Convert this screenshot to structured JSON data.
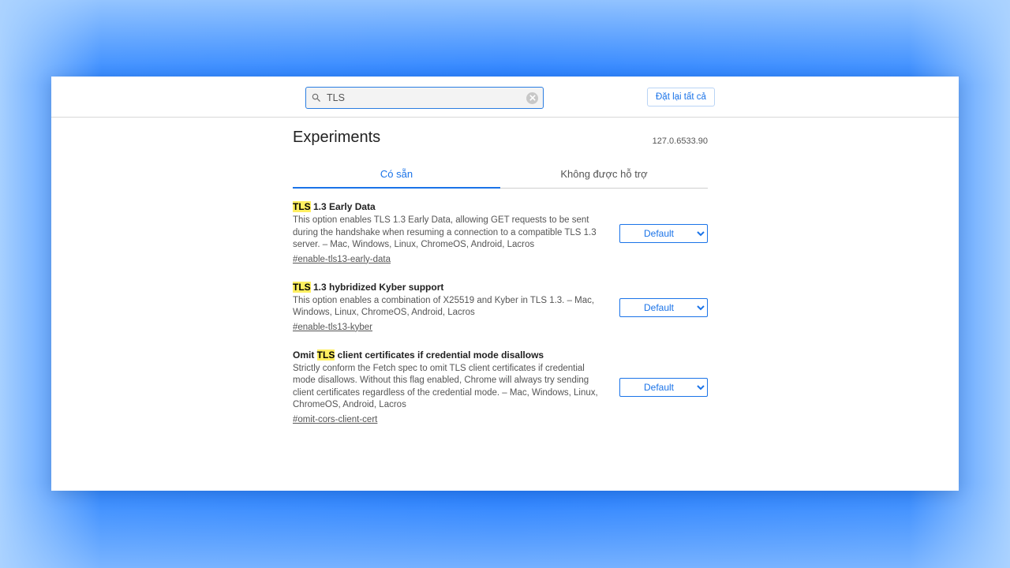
{
  "search": {
    "value": "TLS"
  },
  "reset_label": "Đặt lại tất cả",
  "page_title": "Experiments",
  "version": "127.0.6533.90",
  "tabs": {
    "available": "Có sẵn",
    "unsupported": "Không được hỗ trợ"
  },
  "select": {
    "default_option": "Default"
  },
  "flags": [
    {
      "title_pre": "",
      "title_hl": "TLS",
      "title_post": " 1.3 Early Data",
      "desc": "This option enables TLS 1.3 Early Data, allowing GET requests to be sent during the handshake when resuming a connection to a compatible TLS 1.3 server. – Mac, Windows, Linux, ChromeOS, Android, Lacros",
      "anchor": "#enable-tls13-early-data",
      "value": "Default"
    },
    {
      "title_pre": "",
      "title_hl": "TLS",
      "title_post": " 1.3 hybridized Kyber support",
      "desc": "This option enables a combination of X25519 and Kyber in TLS 1.3. – Mac, Windows, Linux, ChromeOS, Android, Lacros",
      "anchor": "#enable-tls13-kyber",
      "value": "Default"
    },
    {
      "title_pre": "Omit ",
      "title_hl": "TLS",
      "title_post": " client certificates if credential mode disallows",
      "desc": "Strictly conform the Fetch spec to omit TLS client certificates if credential mode disallows. Without this flag enabled, Chrome will always try sending client certificates regardless of the credential mode. – Mac, Windows, Linux, ChromeOS, Android, Lacros",
      "anchor": "#omit-cors-client-cert",
      "value": "Default"
    }
  ]
}
